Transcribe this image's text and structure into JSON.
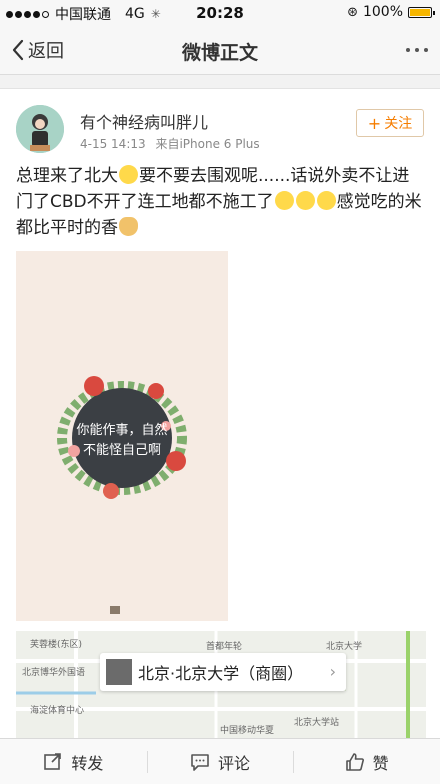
{
  "status": {
    "carrier": "中国联通",
    "network": "4G",
    "time": "20:28",
    "battery": "100%"
  },
  "nav": {
    "back_label": "返回",
    "title": "微博正文"
  },
  "post": {
    "username": "有个神经病叫胖儿",
    "timestamp": "4-15 14:13",
    "source": "来自iPhone 6 Plus",
    "follow_label": "关注",
    "text_part1": "总理来了北大",
    "text_part2": "要不要去围观呢......话说外卖不让进门了CBD不开了连工地都不施工了",
    "text_part3": "感觉吃的米都比平时的香",
    "image_text_line1": "你能作事，自然",
    "image_text_line2": "不能怪自己啊"
  },
  "location": {
    "label": "北京·北京大学（商圈）",
    "map_labels": [
      "芙蓉楼(东区)",
      "北京大学",
      "北京博华外国语",
      "海淀体育中心",
      "首都年轮",
      "中国移动华夏",
      "北京大学站"
    ]
  },
  "toolbar": {
    "repost": "转发",
    "comment": "评论",
    "like": "赞"
  },
  "colors": {
    "accent": "#f57d00",
    "battery": "#f6b600"
  }
}
